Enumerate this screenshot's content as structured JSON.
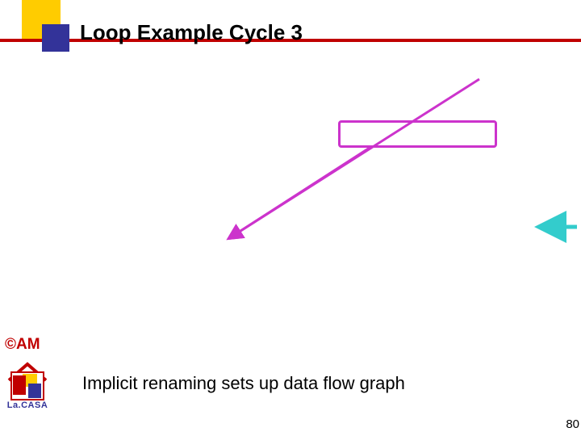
{
  "title": "Loop Example Cycle 3",
  "body_text": "Implicit renaming sets up data flow graph",
  "page_number": "80",
  "copyright": "©AM",
  "logo_label": "La.CASA",
  "colors": {
    "magenta": "#cc33cc",
    "teal": "#33cccc",
    "accent_yellow": "#ffcc00",
    "accent_red": "#c00000",
    "accent_blue": "#333399"
  }
}
